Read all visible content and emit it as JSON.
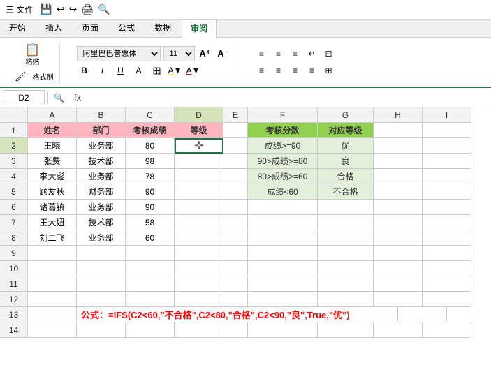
{
  "titlebar": {
    "text": "三 文件",
    "icons": [
      "💾",
      "↩",
      "↪",
      "🖨",
      "🔍",
      "◁",
      "▷"
    ]
  },
  "ribbon": {
    "tabs": [
      "开始",
      "插入",
      "页面",
      "公式",
      "数据",
      "审阅"
    ],
    "active_tab": "开始"
  },
  "toolbar": {
    "format_painter": "格式刷",
    "paste": "粘贴",
    "font_name": "阿里巴巴普惠体",
    "font_size": "11",
    "bold": "B",
    "italic": "I",
    "underline": "U",
    "strikethrough": "A",
    "border": "田",
    "fill_color": "A",
    "font_color": "A"
  },
  "formula_bar": {
    "cell_ref": "D2",
    "fx": "fx",
    "formula": ""
  },
  "columns": [
    "A",
    "B",
    "C",
    "D",
    "E",
    "F",
    "G",
    "H",
    "I"
  ],
  "rows": [
    {
      "num": 1,
      "cells": {
        "A": {
          "value": "姓名",
          "type": "header"
        },
        "B": {
          "value": "部门",
          "type": "header"
        },
        "C": {
          "value": "考核成绩",
          "type": "header"
        },
        "D": {
          "value": "等级",
          "type": "header"
        },
        "E": {
          "value": "",
          "type": "empty"
        },
        "F": {
          "value": "考核分数",
          "type": "green-header"
        },
        "G": {
          "value": "对应等级",
          "type": "green-header"
        },
        "H": {
          "value": "",
          "type": "empty"
        },
        "I": {
          "value": "",
          "type": "empty"
        }
      }
    },
    {
      "num": 2,
      "cells": {
        "A": {
          "value": "王晓",
          "type": "data"
        },
        "B": {
          "value": "业务部",
          "type": "data"
        },
        "C": {
          "value": "80",
          "type": "data"
        },
        "D": {
          "value": "",
          "type": "selected"
        },
        "E": {
          "value": "",
          "type": "empty"
        },
        "F": {
          "value": "成绩>=90",
          "type": "green-data"
        },
        "G": {
          "value": "优",
          "type": "green-data"
        },
        "H": {
          "value": "",
          "type": "empty"
        },
        "I": {
          "value": "",
          "type": "empty"
        }
      }
    },
    {
      "num": 3,
      "cells": {
        "A": {
          "value": "张费",
          "type": "data"
        },
        "B": {
          "value": "技术部",
          "type": "data"
        },
        "C": {
          "value": "98",
          "type": "data"
        },
        "D": {
          "value": "",
          "type": "data"
        },
        "E": {
          "value": "",
          "type": "empty"
        },
        "F": {
          "value": "90>成绩>=80",
          "type": "green-data"
        },
        "G": {
          "value": "良",
          "type": "green-data"
        },
        "H": {
          "value": "",
          "type": "empty"
        },
        "I": {
          "value": "",
          "type": "empty"
        }
      }
    },
    {
      "num": 4,
      "cells": {
        "A": {
          "value": "李大彪",
          "type": "data"
        },
        "B": {
          "value": "业务部",
          "type": "data"
        },
        "C": {
          "value": "78",
          "type": "data"
        },
        "D": {
          "value": "",
          "type": "data"
        },
        "E": {
          "value": "",
          "type": "empty"
        },
        "F": {
          "value": "80>成绩>=60",
          "type": "green-data"
        },
        "G": {
          "value": "合格",
          "type": "green-data"
        },
        "H": {
          "value": "",
          "type": "empty"
        },
        "I": {
          "value": "",
          "type": "empty"
        }
      }
    },
    {
      "num": 5,
      "cells": {
        "A": {
          "value": "顾友秋",
          "type": "data"
        },
        "B": {
          "value": "财务部",
          "type": "data"
        },
        "C": {
          "value": "90",
          "type": "data"
        },
        "D": {
          "value": "",
          "type": "data"
        },
        "E": {
          "value": "",
          "type": "empty"
        },
        "F": {
          "value": "成绩<60",
          "type": "green-data"
        },
        "G": {
          "value": "不合格",
          "type": "green-data"
        },
        "H": {
          "value": "",
          "type": "empty"
        },
        "I": {
          "value": "",
          "type": "empty"
        }
      }
    },
    {
      "num": 6,
      "cells": {
        "A": {
          "value": "诸葛镇",
          "type": "data"
        },
        "B": {
          "value": "业务部",
          "type": "data"
        },
        "C": {
          "value": "90",
          "type": "data"
        },
        "D": {
          "value": "",
          "type": "data"
        },
        "E": {
          "value": "",
          "type": "empty"
        },
        "F": {
          "value": "",
          "type": "empty"
        },
        "G": {
          "value": "",
          "type": "empty"
        },
        "H": {
          "value": "",
          "type": "empty"
        },
        "I": {
          "value": "",
          "type": "empty"
        }
      }
    },
    {
      "num": 7,
      "cells": {
        "A": {
          "value": "王大妞",
          "type": "data"
        },
        "B": {
          "value": "技术部",
          "type": "data"
        },
        "C": {
          "value": "58",
          "type": "data"
        },
        "D": {
          "value": "",
          "type": "data"
        },
        "E": {
          "value": "",
          "type": "empty"
        },
        "F": {
          "value": "",
          "type": "empty"
        },
        "G": {
          "value": "",
          "type": "empty"
        },
        "H": {
          "value": "",
          "type": "empty"
        },
        "I": {
          "value": "",
          "type": "empty"
        }
      }
    },
    {
      "num": 8,
      "cells": {
        "A": {
          "value": "刘二飞",
          "type": "data"
        },
        "B": {
          "value": "业务部",
          "type": "data"
        },
        "C": {
          "value": "60",
          "type": "data"
        },
        "D": {
          "value": "",
          "type": "data"
        },
        "E": {
          "value": "",
          "type": "empty"
        },
        "F": {
          "value": "",
          "type": "empty"
        },
        "G": {
          "value": "",
          "type": "empty"
        },
        "H": {
          "value": "",
          "type": "empty"
        },
        "I": {
          "value": "",
          "type": "empty"
        }
      }
    },
    {
      "num": 9,
      "cells": {
        "A": {
          "value": "",
          "type": "empty"
        },
        "B": {
          "value": "",
          "type": "empty"
        },
        "C": {
          "value": "",
          "type": "empty"
        },
        "D": {
          "value": "",
          "type": "empty"
        },
        "E": {
          "value": "",
          "type": "empty"
        },
        "F": {
          "value": "",
          "type": "empty"
        },
        "G": {
          "value": "",
          "type": "empty"
        },
        "H": {
          "value": "",
          "type": "empty"
        },
        "I": {
          "value": "",
          "type": "empty"
        }
      }
    },
    {
      "num": 10,
      "cells": {
        "A": {
          "value": "",
          "type": "empty"
        },
        "B": {
          "value": "",
          "type": "empty"
        },
        "C": {
          "value": "",
          "type": "empty"
        },
        "D": {
          "value": "",
          "type": "empty"
        },
        "E": {
          "value": "",
          "type": "empty"
        },
        "F": {
          "value": "",
          "type": "empty"
        },
        "G": {
          "value": "",
          "type": "empty"
        },
        "H": {
          "value": "",
          "type": "empty"
        },
        "I": {
          "value": "",
          "type": "empty"
        }
      }
    },
    {
      "num": 11,
      "cells": {
        "A": {
          "value": "",
          "type": "empty"
        },
        "B": {
          "value": "",
          "type": "empty"
        },
        "C": {
          "value": "",
          "type": "empty"
        },
        "D": {
          "value": "",
          "type": "empty"
        },
        "E": {
          "value": "",
          "type": "empty"
        },
        "F": {
          "value": "",
          "type": "empty"
        },
        "G": {
          "value": "",
          "type": "empty"
        },
        "H": {
          "value": "",
          "type": "empty"
        },
        "I": {
          "value": "",
          "type": "empty"
        }
      }
    },
    {
      "num": 12,
      "cells": {
        "A": {
          "value": "",
          "type": "empty"
        },
        "B": {
          "value": "",
          "type": "empty"
        },
        "C": {
          "value": "",
          "type": "empty"
        },
        "D": {
          "value": "",
          "type": "empty"
        },
        "E": {
          "value": "",
          "type": "empty"
        },
        "F": {
          "value": "",
          "type": "empty"
        },
        "G": {
          "value": "",
          "type": "empty"
        },
        "H": {
          "value": "",
          "type": "empty"
        },
        "I": {
          "value": "",
          "type": "empty"
        }
      }
    },
    {
      "num": 13,
      "cells": {
        "A": {
          "value": "",
          "type": "empty"
        },
        "B": {
          "value": "公式：=IFS(C2<60,\"不合格\",C2<80,\"合格\",C2<90,\"良\",True,\"优\")",
          "type": "formula-note",
          "colspan": true
        },
        "C": {
          "value": "",
          "type": "hidden"
        },
        "D": {
          "value": "",
          "type": "hidden"
        },
        "E": {
          "value": "",
          "type": "hidden"
        },
        "F": {
          "value": "",
          "type": "hidden"
        },
        "G": {
          "value": "",
          "type": "hidden"
        },
        "H": {
          "value": "",
          "type": "hidden"
        },
        "I": {
          "value": "",
          "type": "empty"
        }
      }
    },
    {
      "num": 14,
      "cells": {
        "A": {
          "value": "",
          "type": "empty"
        },
        "B": {
          "value": "",
          "type": "empty"
        },
        "C": {
          "value": "",
          "type": "empty"
        },
        "D": {
          "value": "",
          "type": "empty"
        },
        "E": {
          "value": "",
          "type": "empty"
        },
        "F": {
          "value": "",
          "type": "empty"
        },
        "G": {
          "value": "",
          "type": "empty"
        },
        "H": {
          "value": "",
          "type": "empty"
        },
        "I": {
          "value": "",
          "type": "empty"
        }
      }
    }
  ],
  "formula_note_text": "公式：=IFS(C2<60,\"不合格\",C2<80,\"合格\",C2<90,\"良\",True,\"优\")"
}
